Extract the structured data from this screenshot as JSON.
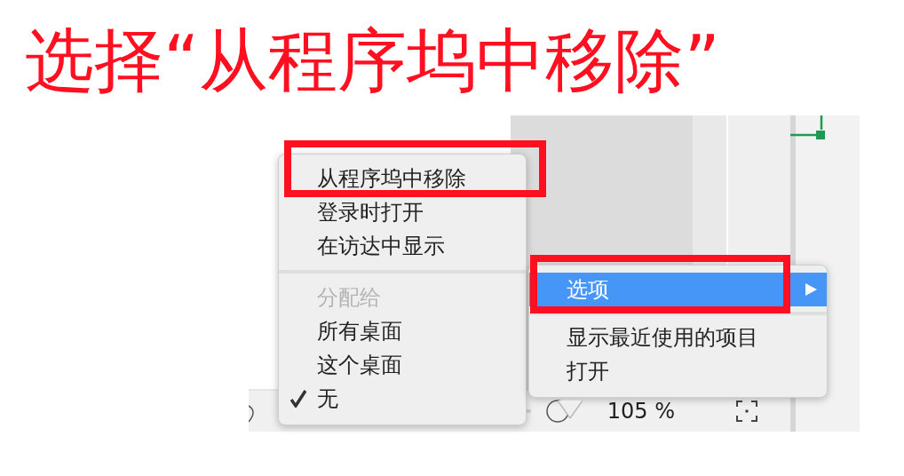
{
  "instruction_title": "选择“从程序坞中移除”",
  "context_menu": {
    "items": [
      {
        "kind": "item",
        "label": "从程序坞中移除",
        "checked": false
      },
      {
        "kind": "item",
        "label": "登录时打开",
        "checked": false
      },
      {
        "kind": "item",
        "label": "在访达中显示",
        "checked": false
      },
      {
        "kind": "separator"
      },
      {
        "kind": "header",
        "label": "分配给"
      },
      {
        "kind": "item",
        "label": "所有桌面",
        "checked": false
      },
      {
        "kind": "item",
        "label": "这个桌面",
        "checked": false
      },
      {
        "kind": "item",
        "label": "无",
        "checked": true
      }
    ]
  },
  "dock_menu": {
    "items": [
      {
        "kind": "item",
        "label": "选项",
        "selected": true,
        "has_submenu": true
      },
      {
        "kind": "separator"
      },
      {
        "kind": "item",
        "label": "显示最近使用的项目",
        "selected": false,
        "has_submenu": false
      },
      {
        "kind": "item",
        "label": "打开",
        "selected": false,
        "has_submenu": false
      }
    ]
  },
  "status_bar": {
    "zoom": "105 %"
  }
}
